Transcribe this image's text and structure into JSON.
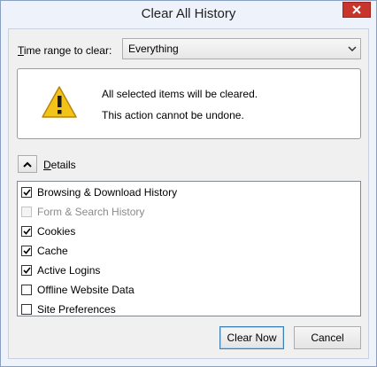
{
  "window": {
    "title": "Clear All History"
  },
  "time_range": {
    "label_prefix": "T",
    "label_rest": "ime range to clear:",
    "selected": "Everything"
  },
  "warning": {
    "line1": "All selected items will be cleared.",
    "line2": "This action cannot be undone."
  },
  "details": {
    "label_prefix": "D",
    "label_rest": "etails",
    "expanded": true
  },
  "items": [
    {
      "label": "Browsing & Download History",
      "checked": true,
      "enabled": true
    },
    {
      "label": "Form & Search History",
      "checked": false,
      "enabled": false
    },
    {
      "label": "Cookies",
      "checked": true,
      "enabled": true
    },
    {
      "label": "Cache",
      "checked": true,
      "enabled": true
    },
    {
      "label": "Active Logins",
      "checked": true,
      "enabled": true
    },
    {
      "label": "Offline Website Data",
      "checked": false,
      "enabled": true
    },
    {
      "label": "Site Preferences",
      "checked": false,
      "enabled": true
    }
  ],
  "buttons": {
    "clear_now": "Clear Now",
    "cancel": "Cancel"
  },
  "icons": {
    "close": "close-icon",
    "dropdown": "chevron-down-icon",
    "warning": "warning-icon",
    "collapse": "chevron-up-icon",
    "check": "checkmark-icon"
  },
  "colors": {
    "close_button": "#c7352c",
    "warning_yellow": "#f2c318",
    "default_button_border": "#3c7fb1"
  }
}
